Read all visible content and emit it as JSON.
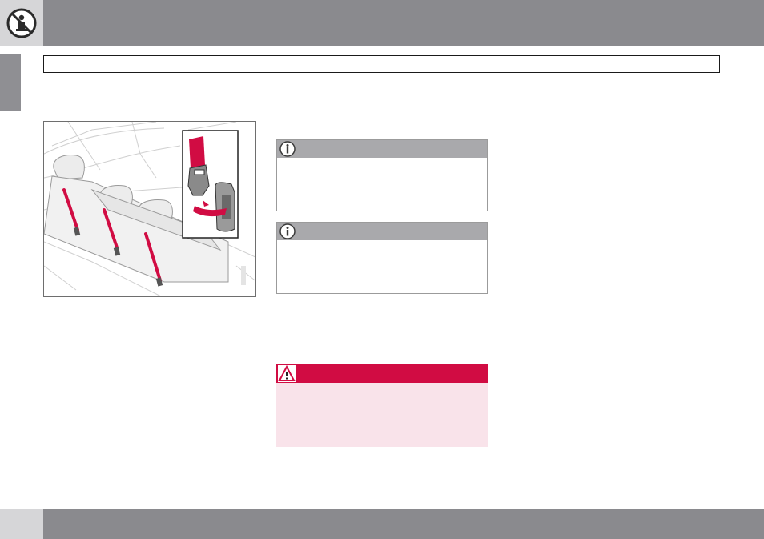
{
  "header": {
    "section_icon": "seatbelt-prohibited-icon",
    "tab_color": "#d6d6d8",
    "bar_color": "#8a8a8e"
  },
  "title_box": {
    "text": ""
  },
  "illustration": {
    "description_icon": "rear-seat-belts-icon",
    "belt_color": "#d10c43"
  },
  "notes": [
    {
      "icon": "info-icon",
      "text": ""
    },
    {
      "icon": "info-icon",
      "text": ""
    }
  ],
  "warning": {
    "icon": "warning-triangle-icon",
    "header_color": "#d10c43",
    "body_color": "#f9e3ea",
    "text": ""
  },
  "footer": {
    "page_number": ""
  }
}
